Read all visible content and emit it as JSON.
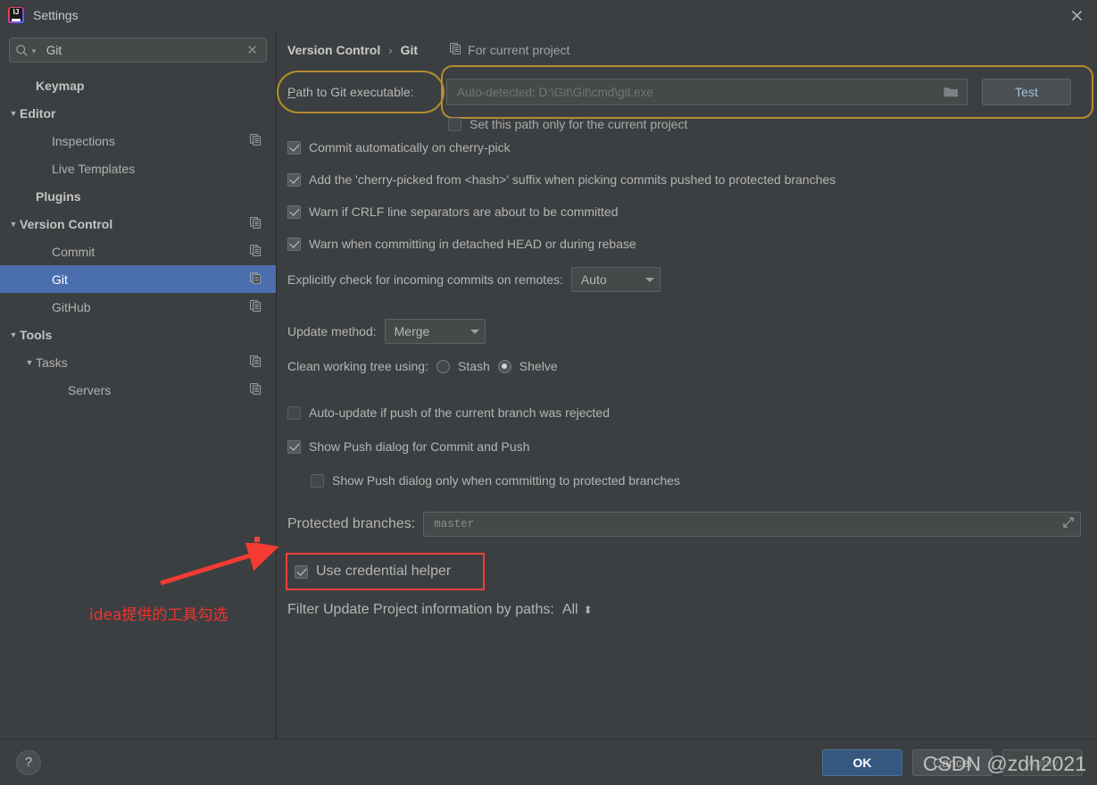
{
  "window": {
    "title": "Settings",
    "logo_icon": "intellij-idea-logo",
    "close_icon": "close-icon"
  },
  "sidebar": {
    "search": {
      "value": "Git",
      "placeholder": "",
      "search_icon": "search-icon",
      "dropdown_icon": "chevron-down-icon",
      "clear_icon": "clear-icon"
    },
    "items": [
      {
        "label": "Keymap",
        "indent": 1,
        "arrow": "",
        "bold": true,
        "selected": false,
        "scope_icon": false
      },
      {
        "label": "Editor",
        "indent": 0,
        "arrow": "▼",
        "bold": true,
        "selected": false,
        "scope_icon": false
      },
      {
        "label": "Inspections",
        "indent": 2,
        "arrow": "",
        "bold": false,
        "selected": false,
        "scope_icon": true
      },
      {
        "label": "Live Templates",
        "indent": 2,
        "arrow": "",
        "bold": false,
        "selected": false,
        "scope_icon": false
      },
      {
        "label": "Plugins",
        "indent": 1,
        "arrow": "",
        "bold": true,
        "selected": false,
        "scope_icon": false
      },
      {
        "label": "Version Control",
        "indent": 0,
        "arrow": "▼",
        "bold": true,
        "selected": false,
        "scope_icon": true
      },
      {
        "label": "Commit",
        "indent": 2,
        "arrow": "",
        "bold": false,
        "selected": false,
        "scope_icon": true
      },
      {
        "label": "Git",
        "indent": 2,
        "arrow": "",
        "bold": false,
        "selected": true,
        "scope_icon": true
      },
      {
        "label": "GitHub",
        "indent": 2,
        "arrow": "",
        "bold": false,
        "selected": false,
        "scope_icon": true
      },
      {
        "label": "Tools",
        "indent": 0,
        "arrow": "▼",
        "bold": true,
        "selected": false,
        "scope_icon": false
      },
      {
        "label": "Tasks",
        "indent": 1,
        "arrow": "▼",
        "bold": false,
        "selected": false,
        "scope_icon": true
      },
      {
        "label": "Servers",
        "indent": 3,
        "arrow": "",
        "bold": false,
        "selected": false,
        "scope_icon": true
      }
    ]
  },
  "header": {
    "breadcrumb_root": "Version Control",
    "breadcrumb_separator": "›",
    "breadcrumb_current": "Git",
    "project_scope_label": "For current project",
    "project_scope_icon": "copy-scope-icon"
  },
  "git_path": {
    "label_prefix": "P",
    "label_rest": "ath to Git executable:",
    "input_value": "",
    "input_placeholder": "Auto-detected: D:\\Git\\Git\\cmd\\git.exe",
    "browse_icon": "folder-icon",
    "test_button": "Test",
    "highlight_color": "#B08D2E",
    "set_path_checkbox": {
      "label": "Set this path only for the current project",
      "checked": false
    }
  },
  "options": {
    "checkboxes_top": [
      {
        "label": "Commit automatically on cherry-pick",
        "checked": true
      },
      {
        "label": "Add the 'cherry-picked from <hash>' suffix when picking commits pushed to protected branches",
        "checked": true
      },
      {
        "label": "Warn if CRLF line separators are about to be committed",
        "checked": true
      },
      {
        "label": "Warn when committing in detached HEAD or during rebase",
        "checked": true
      }
    ],
    "incoming_commits": {
      "label": "Explicitly check for incoming commits on remotes:",
      "value": "Auto"
    },
    "update_method": {
      "label": "Update method:",
      "value": "Merge"
    },
    "clean_working_tree": {
      "label": "Clean working tree using:",
      "options": [
        {
          "label": "Stash",
          "selected": false
        },
        {
          "label": "Shelve",
          "selected": true
        }
      ]
    },
    "auto_update": {
      "label": "Auto-update if push of the current branch was rejected",
      "checked": false
    },
    "show_push_dialog": {
      "label": "Show Push dialog for Commit and Push",
      "checked": true
    },
    "show_push_dialog_protected": {
      "label": "Show Push dialog only when committing to protected branches",
      "checked": false
    },
    "protected_branches": {
      "label": "Protected branches:",
      "value": "master",
      "expand_icon": "expand-icon"
    },
    "use_credential_helper": {
      "label": "Use credential helper",
      "checked": true,
      "highlight_color": "#E8413B"
    },
    "filter_update": {
      "label": "Filter Update Project information by paths:",
      "value": "All",
      "spinner_icon": "updown-arrows-icon"
    }
  },
  "annotation": {
    "text": "idea提供的工具勾选",
    "color": "#F0342F",
    "arrow_icon": "red-arrow-icon"
  },
  "footer": {
    "help_label": "?",
    "ok_label": "OK",
    "cancel_label": "Cancel",
    "apply_label": "Apply"
  },
  "watermark": {
    "text": "CSDN @zdh2021"
  }
}
